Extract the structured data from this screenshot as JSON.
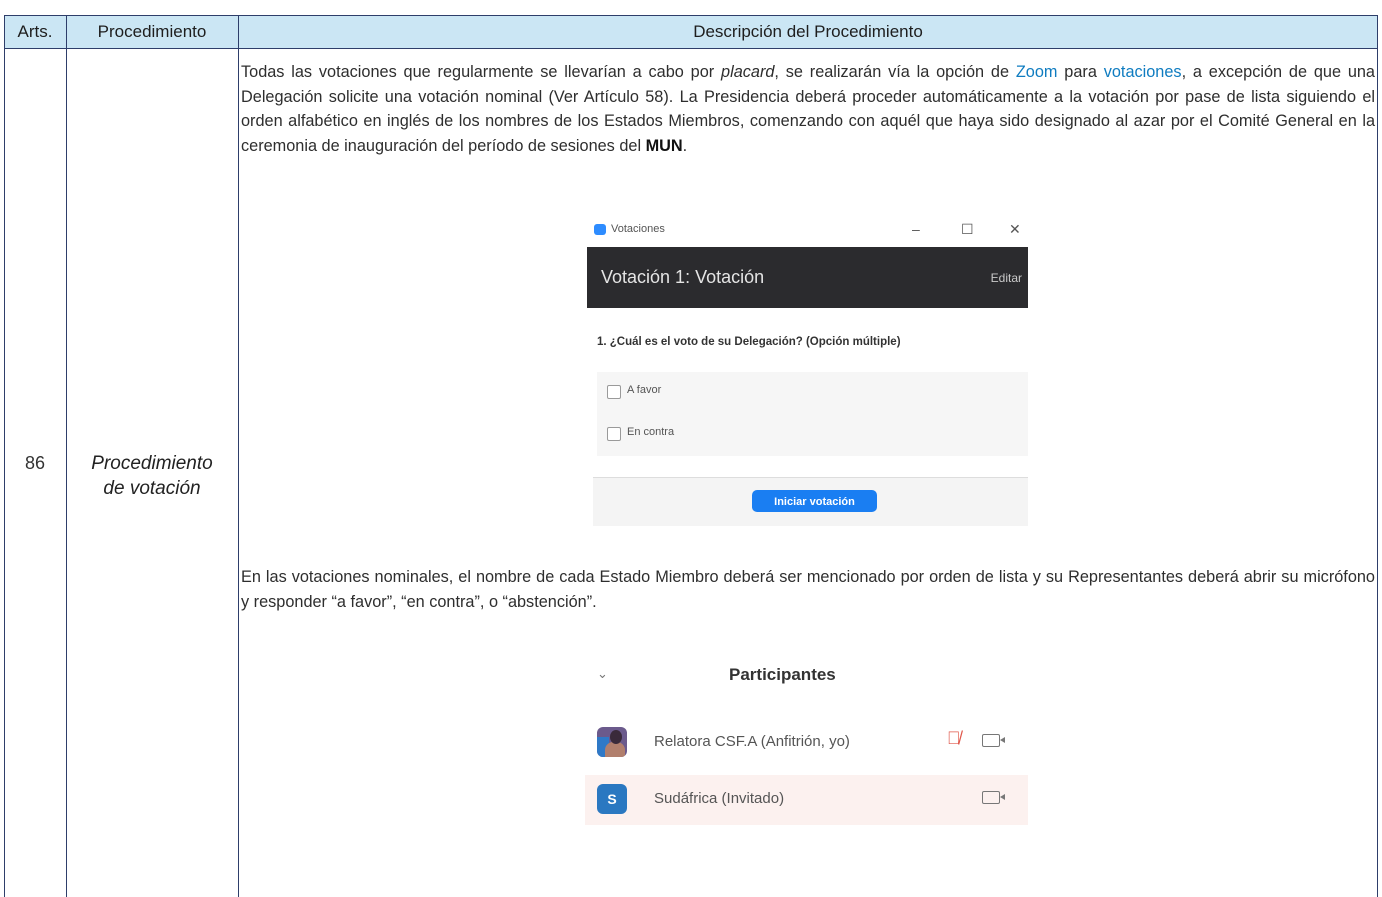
{
  "header": {
    "col_arts": "Arts.",
    "col_procedimiento": "Procedimiento",
    "col_descripcion": "Descripción del Procedimiento"
  },
  "row": {
    "number": "86",
    "procedure_line1": "Procedimiento",
    "procedure_line2": "de votación"
  },
  "paragraph1": {
    "t1": "Todas las votaciones que regularmente se llevarían a cabo por ",
    "placard": "placard",
    "t2": ", se realizarán vía la opción de ",
    "zoom": "Zoom",
    "t3": " para ",
    "votaciones": "votaciones",
    "t4": ", a excepción de que una Delegación solicite una votación nominal (Ver Artículo 58). La Presidencia deberá proceder automáticamente a la votación por pase de lista siguiendo el orden alfabético en inglés de los nombres de los Estados Miembros, comenzando con aquél que haya sido designado al azar por el Comité General en la ceremonia de inauguración del período de sesiones del ",
    "mun": "MUN",
    "t5": "."
  },
  "vote_window": {
    "window_title": "Votaciones",
    "minimize": "–",
    "maximize": "☐",
    "close": "✕",
    "header_title": "Votación 1: Votación",
    "edit": "Editar",
    "question": "1. ¿Cuál es el voto de su Delegación? (Opción múltiple)",
    "options": [
      "A favor",
      "En contra"
    ],
    "start_button": "Iniciar votación"
  },
  "paragraph2": "En las votaciones nominales, el nombre de cada Estado Miembro deberá ser mencionado por orden de lista y su Representantes deberá abrir su micrófono y responder “a favor”, “en contra”, o “abstención”.",
  "participants": {
    "title": "Participantes",
    "rows": [
      {
        "name": "Relatora CSF.A (Anfitrión, yo)",
        "avatar": "photo",
        "muted": true
      },
      {
        "name": "Sudáfrica (Invitado)",
        "avatar": "S",
        "muted": false
      }
    ]
  },
  "colors": {
    "header_bg": "#cbe6f4",
    "border": "#2e3e6a",
    "link": "#0f7cc0",
    "zoom_blue": "#1a7ef2"
  }
}
